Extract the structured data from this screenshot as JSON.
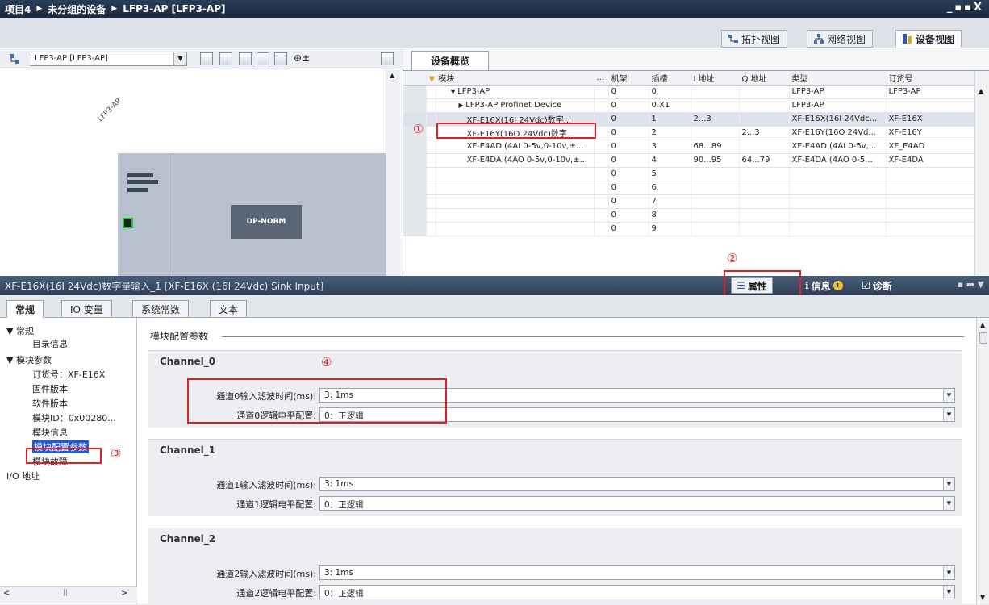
{
  "window": {
    "breadcrumb": [
      "项目4",
      "未分组的设备",
      "LFP3-AP [LFP3-AP]"
    ],
    "controls": "_▪▪X"
  },
  "views": {
    "topology": "拓扑视图",
    "network": "网络视图",
    "device": "设备视图"
  },
  "left_toolbar": {
    "device_select": "LFP3-AP [LFP3-AP]"
  },
  "canvas": {
    "device_label": "LFP3-AP",
    "module_label": "DP-NORM"
  },
  "overview": {
    "tab": "设备概览",
    "columns": [
      "模块",
      "...",
      "机架",
      "插槽",
      "I 地址",
      "Q 地址",
      "类型",
      "订货号"
    ],
    "rows": [
      {
        "module": "LFP3-AP",
        "rack": "0",
        "slot": "0",
        "i": "",
        "q": "",
        "type": "LFP3-AP",
        "order": "LFP3-AP",
        "indent": 1,
        "arrow": "▼"
      },
      {
        "module": "LFP3-AP Profinet Device",
        "rack": "0",
        "slot": "0 X1",
        "i": "",
        "q": "",
        "type": "LFP3-AP",
        "order": "",
        "indent": 2,
        "arrow": "▶"
      },
      {
        "module": "XF-E16X(16I 24Vdc)数字...",
        "rack": "0",
        "slot": "1",
        "i": "2...3",
        "q": "",
        "type": "XF-E16X(16I 24Vdc...",
        "order": "XF-E16X",
        "indent": 3,
        "arrow": ""
      },
      {
        "module": "XF-E16Y(16O 24Vdc)数字...",
        "rack": "0",
        "slot": "2",
        "i": "",
        "q": "2...3",
        "type": "XF-E16Y(16O 24Vd...",
        "order": "XF-E16Y",
        "indent": 3,
        "arrow": ""
      },
      {
        "module": "XF-E4AD (4AI 0-5v,0-10v,±...",
        "rack": "0",
        "slot": "3",
        "i": "68...89",
        "q": "",
        "type": "XF-E4AD (4AI 0-5v,...",
        "order": "XF_E4AD",
        "indent": 3,
        "arrow": ""
      },
      {
        "module": "XF-E4DA (4AO 0-5v,0-10v,±...",
        "rack": "0",
        "slot": "4",
        "i": "90...95",
        "q": "64...79",
        "type": "XF-E4DA (4AO 0-5...",
        "order": "XF-E4DA",
        "indent": 3,
        "arrow": ""
      },
      {
        "module": "",
        "rack": "0",
        "slot": "5",
        "i": "",
        "q": "",
        "type": "",
        "order": "",
        "indent": 0,
        "arrow": ""
      },
      {
        "module": "",
        "rack": "0",
        "slot": "6",
        "i": "",
        "q": "",
        "type": "",
        "order": "",
        "indent": 0,
        "arrow": ""
      },
      {
        "module": "",
        "rack": "0",
        "slot": "7",
        "i": "",
        "q": "",
        "type": "",
        "order": "",
        "indent": 0,
        "arrow": ""
      },
      {
        "module": "",
        "rack": "0",
        "slot": "8",
        "i": "",
        "q": "",
        "type": "",
        "order": "",
        "indent": 0,
        "arrow": ""
      },
      {
        "module": "",
        "rack": "0",
        "slot": "9",
        "i": "",
        "q": "",
        "type": "",
        "order": "",
        "indent": 0,
        "arrow": ""
      }
    ]
  },
  "properties": {
    "title": "XF-E16X(16I 24Vdc)数字量输入_1 [XF-E16X (16I 24Vdc) Sink Input]",
    "tab_props": "属性",
    "tab_info": "信息",
    "tab_diag": "诊断",
    "subtabs": [
      "常规",
      "IO 变量",
      "系统常数",
      "文本"
    ]
  },
  "nav": [
    {
      "label": "▼ 常规",
      "level": 0
    },
    {
      "label": "目录信息",
      "level": 1
    },
    {
      "label": "▼ 模块参数",
      "level": 0
    },
    {
      "label": "订货号：XF-E16X",
      "level": 1
    },
    {
      "label": "固件版本",
      "level": 1
    },
    {
      "label": "软件版本",
      "level": 1
    },
    {
      "label": "模块ID：0x00280...",
      "level": 1
    },
    {
      "label": "模块信息",
      "level": 1
    },
    {
      "label": "模块配置参数",
      "level": 1
    },
    {
      "label": "模块故障",
      "level": 1
    },
    {
      "label": "I/O 地址",
      "level": 0
    }
  ],
  "section_title": "模块配置参数",
  "channels": [
    {
      "name": "Channel_0",
      "filter_label": "通道0输入滤波时间(ms):",
      "filter_value": "3: 1ms",
      "logic_label": "通道0逻辑电平配置:",
      "logic_value": "0：正逻辑"
    },
    {
      "name": "Channel_1",
      "filter_label": "通道1输入滤波时间(ms):",
      "filter_value": "3: 1ms",
      "logic_label": "通道1逻辑电平配置:",
      "logic_value": "0：正逻辑"
    },
    {
      "name": "Channel_2",
      "filter_label": "通道2输入滤波时间(ms):",
      "filter_value": "3: 1ms",
      "logic_label": "通道2逻辑电平配置:",
      "logic_value": "0：正逻辑"
    }
  ],
  "annotations": [
    "①",
    "②",
    "③",
    "④"
  ]
}
